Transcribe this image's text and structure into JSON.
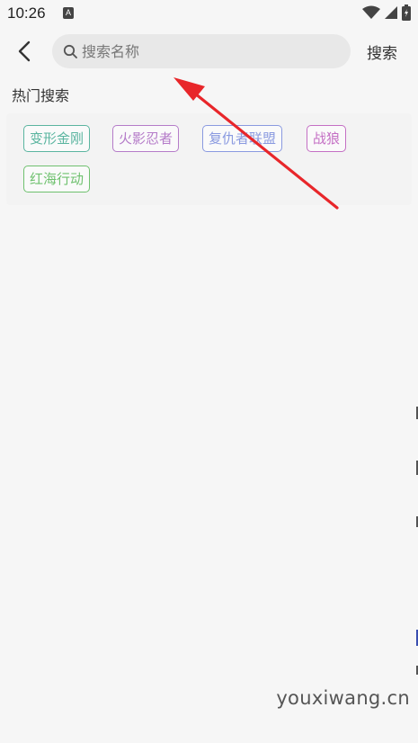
{
  "status_bar": {
    "time": "10:26",
    "notification_glyph": "A",
    "icons": [
      "wifi-icon",
      "signal-icon",
      "battery-icon"
    ]
  },
  "header": {
    "back_icon": "chevron-left-icon",
    "search": {
      "placeholder": "搜索名称",
      "value": ""
    },
    "search_button_label": "搜索"
  },
  "hot_search": {
    "title": "热门搜索",
    "tags": [
      {
        "label": "变形金刚",
        "color": "#5bb5a0"
      },
      {
        "label": "火影忍者",
        "color": "#b57cc9"
      },
      {
        "label": "复仇者联盟",
        "color": "#8a9ae0"
      },
      {
        "label": "战狼",
        "color": "#c46fc4"
      },
      {
        "label": "红海行动",
        "color": "#6fc16f"
      }
    ]
  },
  "annotation_arrow_color": "#e8262a",
  "watermark": "youxiwang.cn"
}
